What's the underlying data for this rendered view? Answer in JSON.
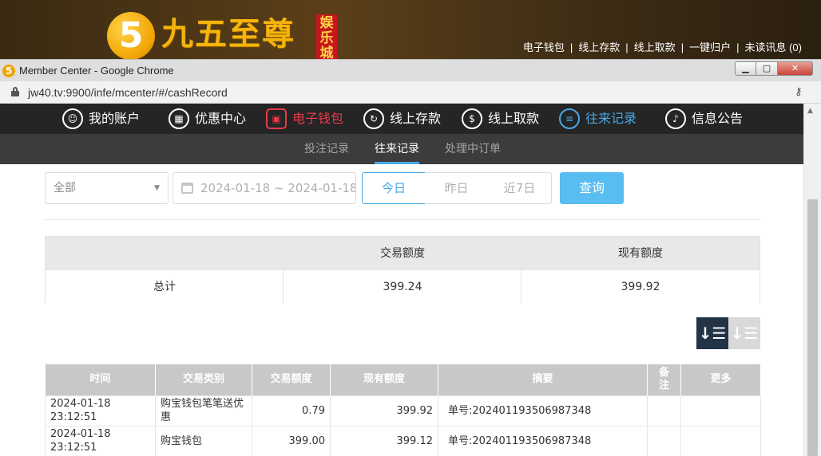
{
  "site": {
    "logo_mark": "5",
    "logo_text": "九五至尊",
    "logo_tag": "娱乐城",
    "top_links": [
      "电子钱包",
      "线上存款",
      "线上取款",
      "一键归户",
      "未读讯息 (0)"
    ]
  },
  "window": {
    "title": "Member Center - Google Chrome",
    "url": "jw40.tv:9900/infe/mcenter/#/cashRecord",
    "controls": {
      "minimize": "▁",
      "maximize": "▢",
      "close": "✕"
    }
  },
  "main_nav": {
    "items": [
      {
        "label": "我的账户",
        "icon": "user-icon",
        "glyph": "☺"
      },
      {
        "label": "优惠中心",
        "icon": "gift-icon",
        "glyph": "▦"
      },
      {
        "label": "电子钱包",
        "icon": "wallet-icon",
        "glyph": "▣"
      },
      {
        "label": "线上存款",
        "icon": "deposit-icon",
        "glyph": "↻"
      },
      {
        "label": "线上取款",
        "icon": "withdraw-icon",
        "glyph": "$"
      },
      {
        "label": "往来记录",
        "icon": "record-icon",
        "glyph": "≡"
      },
      {
        "label": "信息公告",
        "icon": "bell-icon",
        "glyph": "♪"
      }
    ],
    "active_label": "往来记录",
    "colors": {
      "active_blue": "#49a7e6",
      "wallet_red": "#e83a4a"
    }
  },
  "sub_nav": {
    "items": [
      "投注记录",
      "往来记录",
      "处理中订单"
    ],
    "active": "往来记录"
  },
  "filter": {
    "type_select": "全部",
    "date_range": "2024-01-18 ~ 2024-01-18",
    "quick_ranges": [
      "今日",
      "昨日",
      "近7日"
    ],
    "active_range": "今日",
    "query_label": "查询"
  },
  "summary": {
    "headers": [
      "交易额度",
      "现有额度"
    ],
    "row_label": "总计",
    "values": [
      "399.24",
      "399.92"
    ]
  },
  "sort": {
    "desc_glyph": "↓☰",
    "asc_glyph": "↓☰"
  },
  "records": {
    "headers": [
      "时间",
      "交易类别",
      "交易额度",
      "现有额度",
      "摘要",
      "备注",
      "更多"
    ],
    "rows": [
      [
        "2024-01-18 23:12:51",
        "购宝钱包笔笔送优惠",
        "0.79",
        "399.92",
        "单号:202401193506987348",
        "",
        ""
      ],
      [
        "2024-01-18 23:12:51",
        "购宝钱包",
        "399.00",
        "399.12",
        "单号:202401193506987348",
        "",
        ""
      ]
    ]
  }
}
